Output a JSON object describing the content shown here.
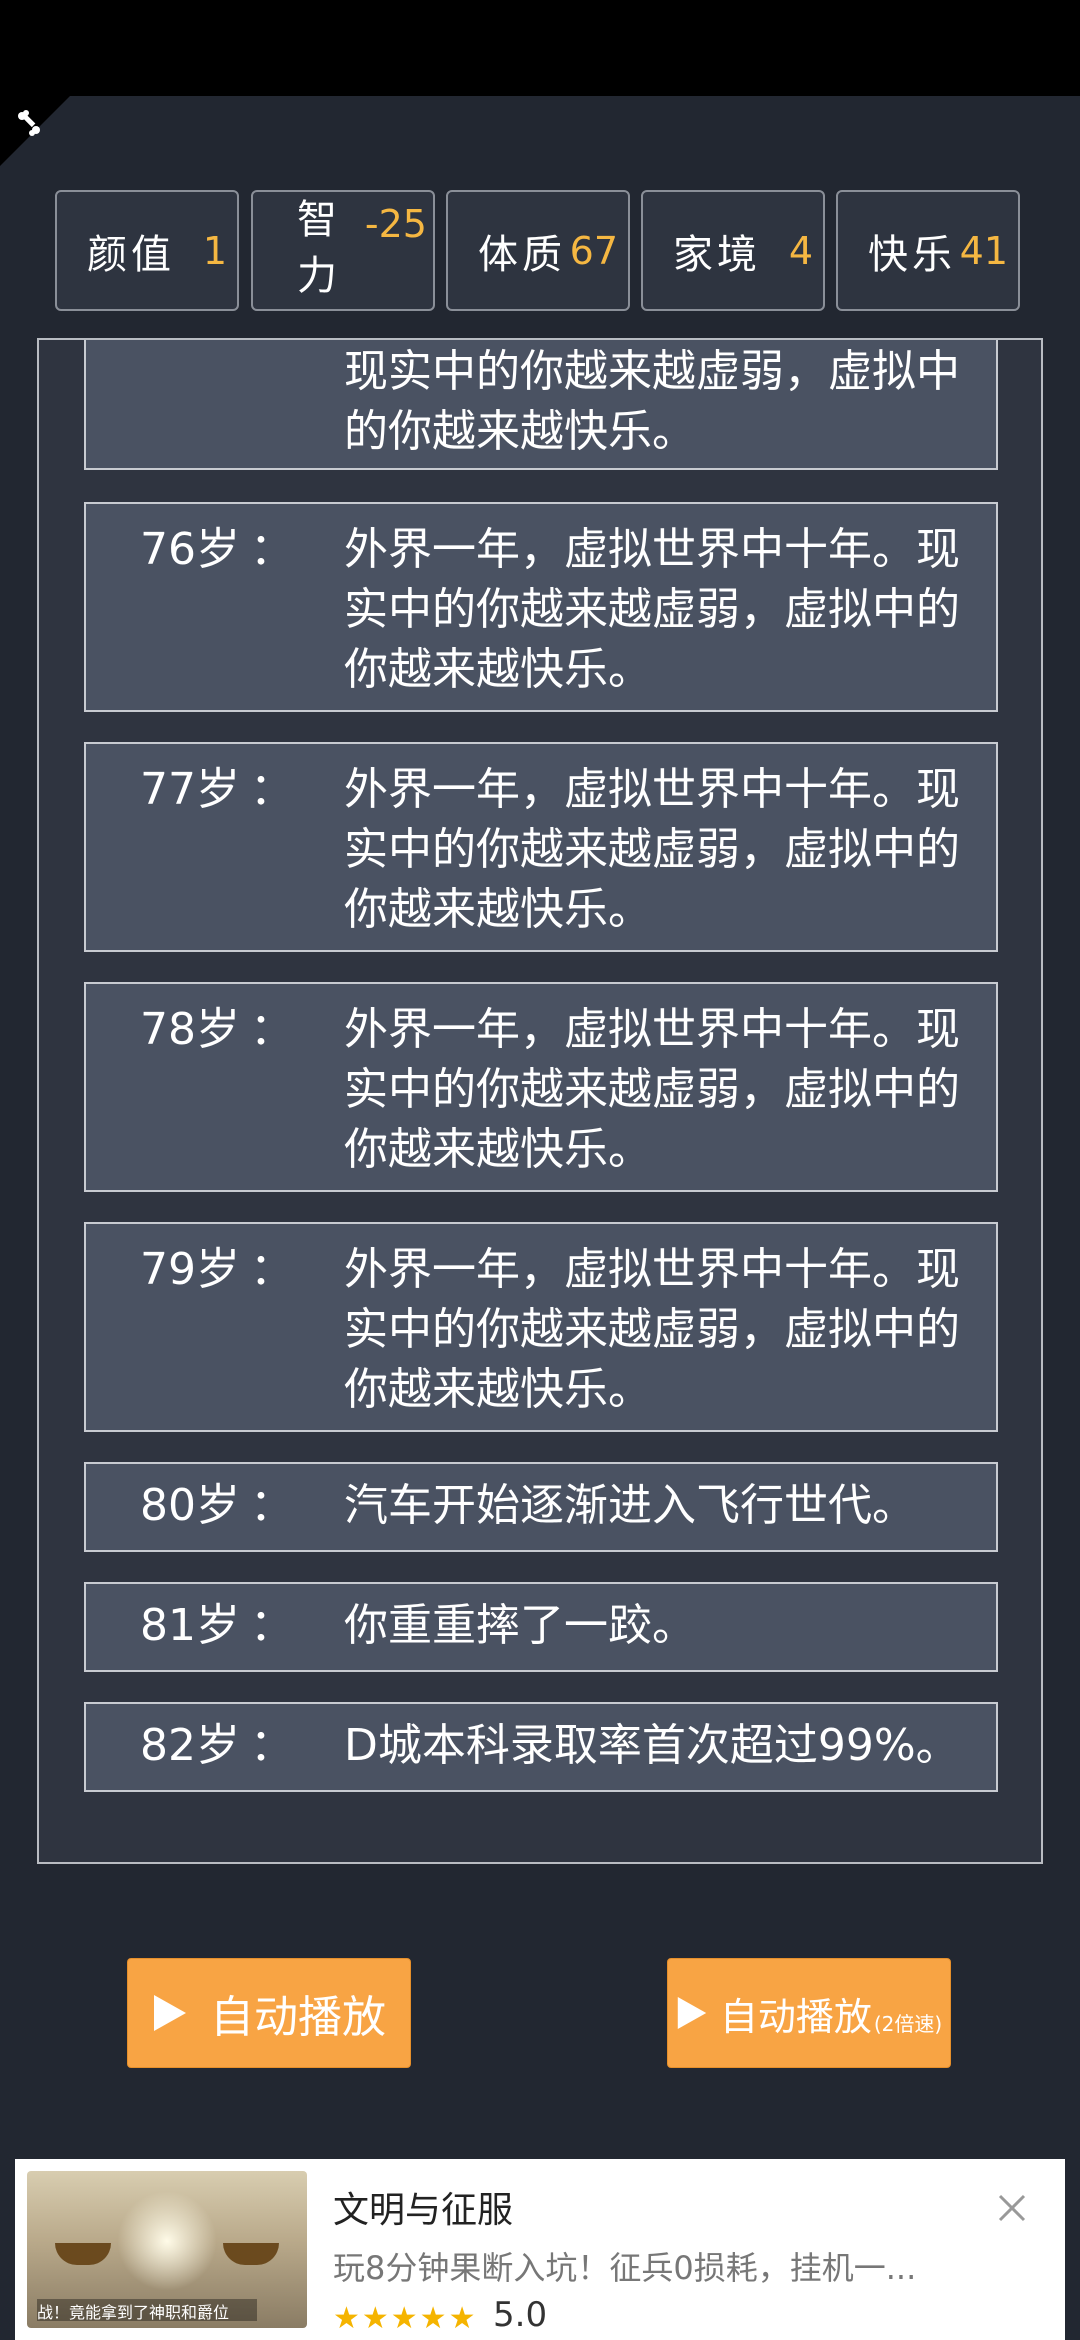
{
  "stats": [
    {
      "label": "颜值",
      "value": "1"
    },
    {
      "label": "智力",
      "value": "-25"
    },
    {
      "label": "体质",
      "value": "67"
    },
    {
      "label": "家境",
      "value": "4"
    },
    {
      "label": "快乐",
      "value": "41"
    }
  ],
  "events": [
    {
      "age": "",
      "text": "现实中的你越来越虚弱，虚拟中的你越来越快乐。"
    },
    {
      "age": "76岁",
      "text": "外界一年，虚拟世界中十年。现实中的你越来越虚弱，虚拟中的你越来越快乐。"
    },
    {
      "age": "77岁",
      "text": "外界一年，虚拟世界中十年。现实中的你越来越虚弱，虚拟中的你越来越快乐。"
    },
    {
      "age": "78岁",
      "text": "外界一年，虚拟世界中十年。现实中的你越来越虚弱，虚拟中的你越来越快乐。"
    },
    {
      "age": "79岁",
      "text": "外界一年，虚拟世界中十年。现实中的你越来越虚弱，虚拟中的你越来越快乐。"
    },
    {
      "age": "80岁",
      "text": "汽车开始逐渐进入飞行世代。"
    },
    {
      "age": "81岁",
      "text": "你重重摔了一跤。"
    },
    {
      "age": "82岁",
      "text": "D城本科录取率首次超过99%。"
    }
  ],
  "colon": "：",
  "buttons": {
    "autoplay": "自动播放",
    "autoplay2": "自动播放",
    "autoplay2_sub": "(2倍速)"
  },
  "ad": {
    "title": "文明与征服",
    "description": "玩8分钟果断入坑！征兵0损耗，挂机一...",
    "stars": "★★★★★",
    "rating": "5.0",
    "image_caption": "战！竟能拿到了神职和爵位"
  },
  "colors": {
    "accent": "#f8a444",
    "value": "#f5b742",
    "background": "#222731"
  }
}
